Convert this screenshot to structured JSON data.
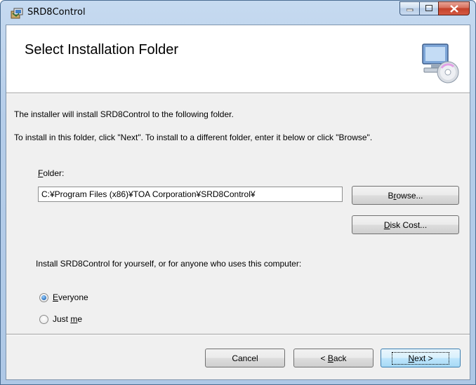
{
  "window": {
    "title": "SRD8Control"
  },
  "banner": {
    "title": "Select Installation Folder"
  },
  "body": {
    "line1": "The installer will install SRD8Control to the following folder.",
    "line2": "To install in this folder, click \"Next\". To install to a different folder, enter it below or click \"Browse\"."
  },
  "folder": {
    "label_accel": "F",
    "label_rest": "older:",
    "value": "C:¥Program Files (x86)¥TOA Corporation¥SRD8Control¥"
  },
  "buttons": {
    "browse_pre": "B",
    "browse_accel": "r",
    "browse_post": "owse...",
    "diskcost_accel": "D",
    "diskcost_post": "isk Cost...",
    "cancel": "Cancel",
    "back_pre": "< ",
    "back_accel": "B",
    "back_post": "ack",
    "next_accel": "N",
    "next_post": "ext >"
  },
  "install_for": {
    "text": "Install SRD8Control for yourself, or for anyone who uses this computer:",
    "options": [
      {
        "pre": "",
        "accel": "E",
        "post": "veryone",
        "selected": true
      },
      {
        "pre": "Just ",
        "accel": "m",
        "post": "e",
        "selected": false
      }
    ]
  },
  "icons": {
    "app": "installer-icon",
    "banner": "computer-cd-icon"
  }
}
